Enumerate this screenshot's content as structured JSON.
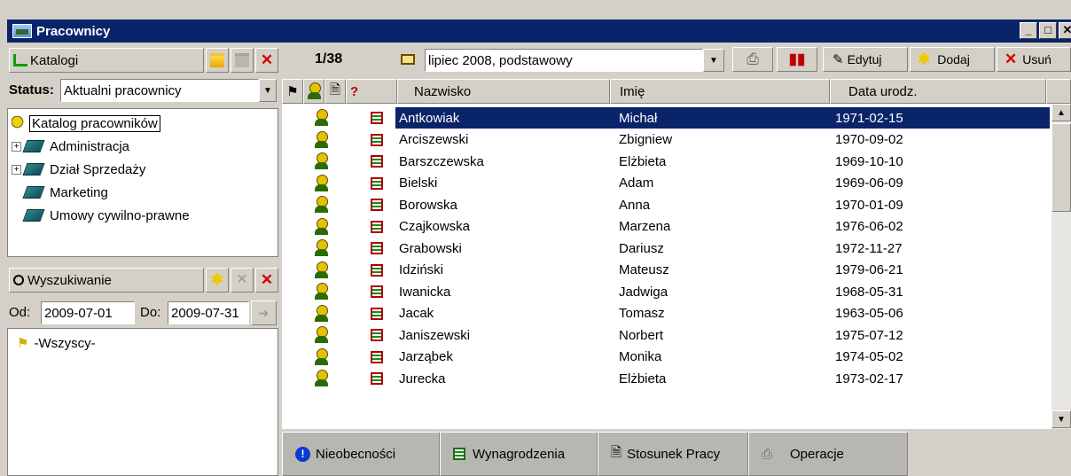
{
  "window": {
    "title": "Pracownicy"
  },
  "katalogi": {
    "label": "Katalogi"
  },
  "status": {
    "label": "Status:",
    "value": "Aktualni pracownicy"
  },
  "tree": {
    "root": "Katalog pracowników",
    "items": [
      "Administracja",
      "Dział Sprzedaży",
      "Marketing",
      "Umowy cywilno-prawne"
    ]
  },
  "search": {
    "label": "Wyszukiwanie",
    "from_label": "Od:",
    "from_value": "2009-07-01",
    "to_label": "Do:",
    "to_value": "2009-07-31",
    "result": "-Wszyscy-"
  },
  "toolbar": {
    "counter": "1/38",
    "period": "lipiec 2008, podstawowy",
    "edit": "Edytuj",
    "add": "Dodaj",
    "delete": "Usuń"
  },
  "grid": {
    "columns": [
      "Nazwisko",
      "Imię",
      "Data urodz."
    ],
    "rows": [
      [
        "Antkowiak",
        "Michał",
        "1971-02-15"
      ],
      [
        "Arciszewski",
        "Zbigniew",
        "1970-09-02"
      ],
      [
        "Barszczewska",
        "Elżbieta",
        "1969-10-10"
      ],
      [
        "Bielski",
        "Adam",
        "1969-06-09"
      ],
      [
        "Borowska",
        "Anna",
        "1970-01-09"
      ],
      [
        "Czajkowska",
        "Marzena",
        "1976-06-02"
      ],
      [
        "Grabowski",
        "Dariusz",
        "1972-11-27"
      ],
      [
        "Idziński",
        "Mateusz",
        "1979-06-21"
      ],
      [
        "Iwanicka",
        "Jadwiga",
        "1968-05-31"
      ],
      [
        "Jacak",
        "Tomasz",
        "1963-05-06"
      ],
      [
        "Janiszewski",
        "Norbert",
        "1975-07-12"
      ],
      [
        "Jarząbek",
        "Monika",
        "1974-05-02"
      ],
      [
        "Jurecka",
        "Elżbieta",
        "1973-02-17"
      ]
    ]
  },
  "tabs": {
    "absences": "Nieobecności",
    "salaries": "Wynagrodzenia",
    "employment": "Stosunek Pracy",
    "operations": "Operacje"
  }
}
